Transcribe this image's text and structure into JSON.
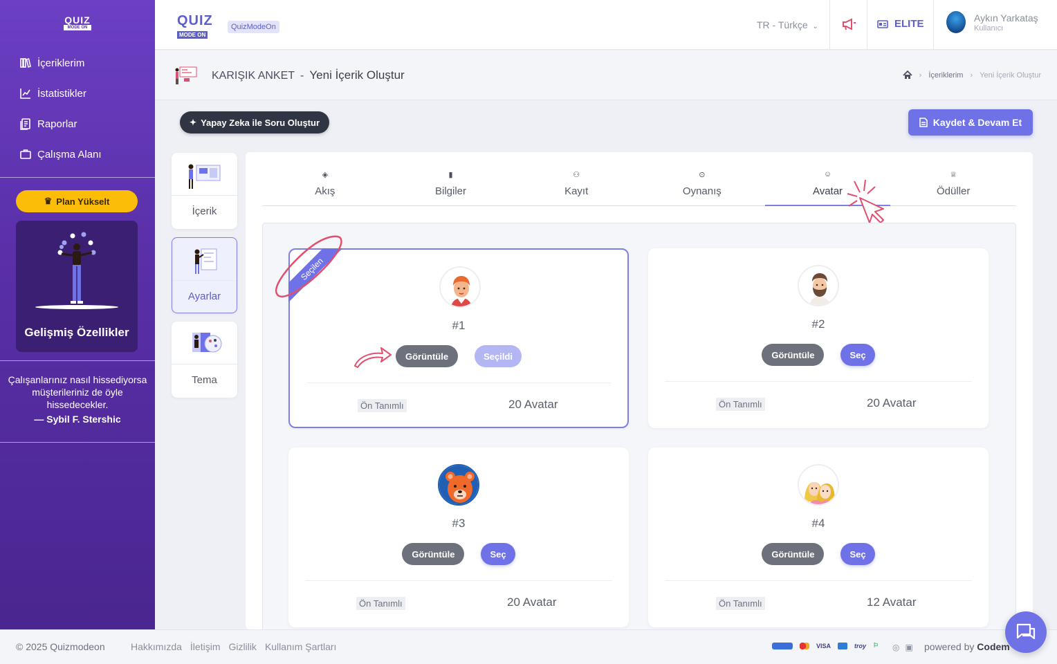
{
  "sidebar": {
    "logo_top": "QUIZ",
    "logo_bottom": "MODE ON",
    "items": [
      {
        "label": "İçeriklerim",
        "icon": "library-icon"
      },
      {
        "label": "İstatistikler",
        "icon": "chart-line-icon"
      },
      {
        "label": "Raporlar",
        "icon": "report-icon"
      },
      {
        "label": "Çalışma Alanı",
        "icon": "briefcase-icon"
      }
    ],
    "plan_button": "Plan Yükselt",
    "advanced_title": "Gelişmiş Özellikler",
    "quote_text": "Çalışanlarınız nasıl hissediyorsa müşterileriniz de öyle hissedecekler.",
    "quote_author": "— Sybil F. Stershic"
  },
  "header": {
    "logo_top": "QUIZ",
    "logo_bottom": "MODE ON",
    "badge": "QuizModeOn",
    "language": "TR - Türkçe",
    "plan": "ELITE",
    "user_name": "Aykın Yarkataş",
    "user_role": "Kullanıcı"
  },
  "subheader": {
    "title": "KARIŞIK ANKET",
    "dash": "-",
    "subtitle": "Yeni İçerik Oluştur",
    "breadcrumb": [
      "İçeriklerim",
      "Yeni İçerik Oluştur"
    ]
  },
  "actions": {
    "ai_button": "Yapay Zeka ile Soru Oluştur",
    "save_button": "Kaydet & Devam Et"
  },
  "steps": [
    {
      "label": "İçerik",
      "active": false
    },
    {
      "label": "Ayarlar",
      "active": true
    },
    {
      "label": "Tema",
      "active": false
    }
  ],
  "tabs": [
    {
      "label": "Akış",
      "active": false
    },
    {
      "label": "Bilgiler",
      "active": false
    },
    {
      "label": "Kayıt",
      "active": false
    },
    {
      "label": "Oynanış",
      "active": false
    },
    {
      "label": "Avatar",
      "active": true
    },
    {
      "label": "Ödüller",
      "active": false
    }
  ],
  "avatars": [
    {
      "number": "#1",
      "view": "Görüntüle",
      "select": "Seçildi",
      "selected": true,
      "ribbon": "Seçilen",
      "tag": "Ön Tanımlı",
      "count": "20 Avatar"
    },
    {
      "number": "#2",
      "view": "Görüntüle",
      "select": "Seç",
      "selected": false,
      "tag": "Ön Tanımlı",
      "count": "20 Avatar"
    },
    {
      "number": "#3",
      "view": "Görüntüle",
      "select": "Seç",
      "selected": false,
      "tag": "Ön Tanımlı",
      "count": "20 Avatar"
    },
    {
      "number": "#4",
      "view": "Görüntüle",
      "select": "Seç",
      "selected": false,
      "tag": "Ön Tanımlı",
      "count": "12 Avatar"
    }
  ],
  "footer": {
    "copyright": "© 2025 Quizmodeon",
    "links": [
      "Hakkımızda",
      "İletişim",
      "Gizlilik",
      "Kullanım Şartları"
    ],
    "payments": [
      "VISA",
      "troy"
    ],
    "powered": "powered by",
    "powered_brand": "Codem"
  },
  "colors": {
    "primary": "#6f72e6",
    "sidebar": "#5a2fa8",
    "warning": "#fbbd08",
    "annotation": "#e0506e"
  }
}
